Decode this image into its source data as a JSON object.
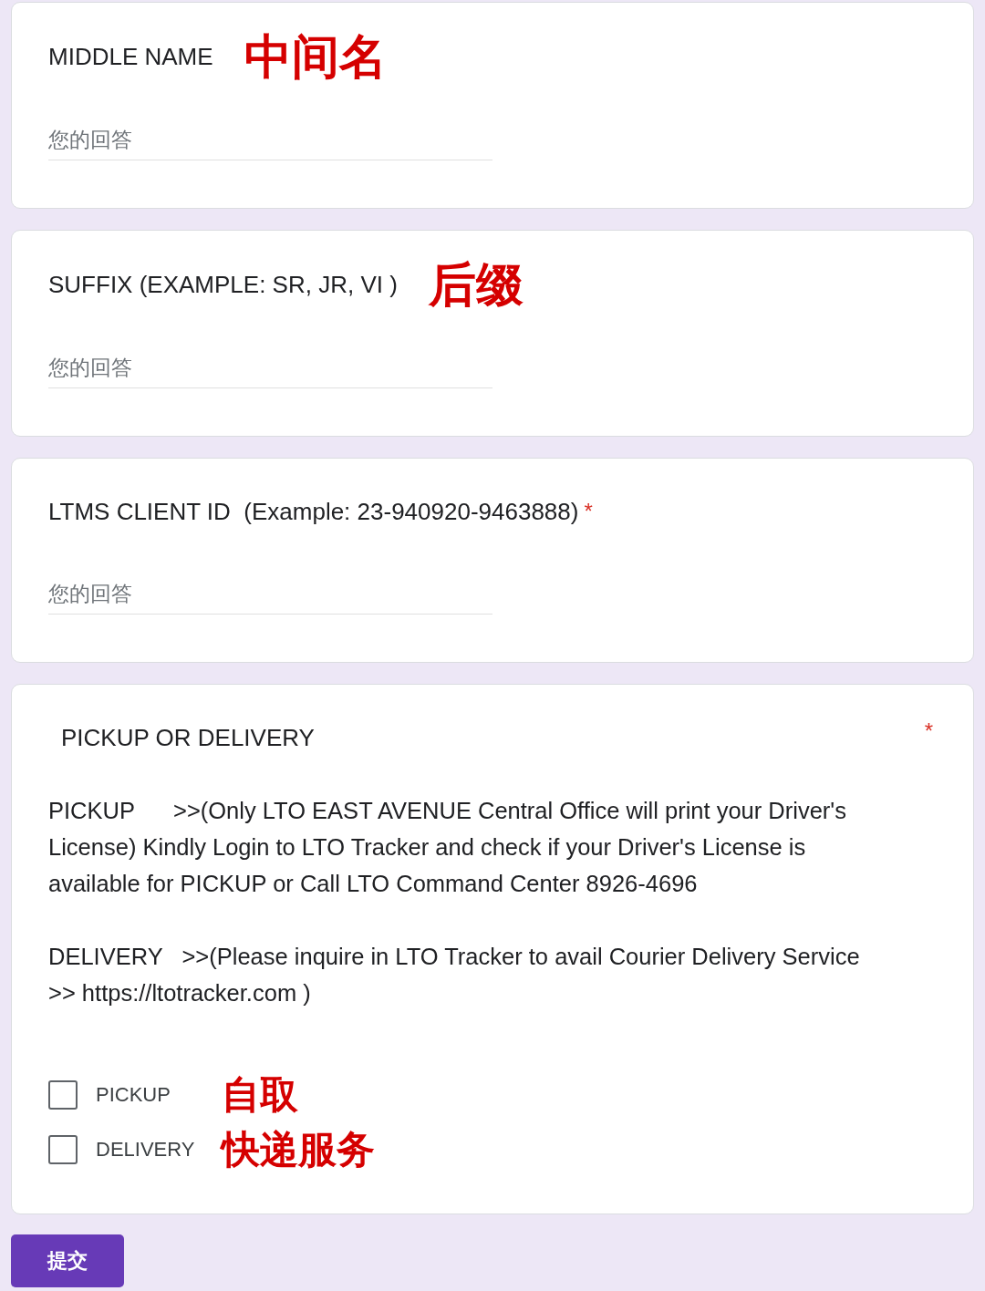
{
  "questions": [
    {
      "kind": "text",
      "title": "MIDDLE NAME",
      "annotation": "中间名",
      "placeholder": "您的回答"
    },
    {
      "kind": "text",
      "title": "SUFFIX (EXAMPLE: SR, JR, VI )",
      "annotation": "后缀",
      "placeholder": "您的回答"
    },
    {
      "kind": "text",
      "title": "LTMS CLIENT ID  (Example: 23-940920-9463888)",
      "required_mark": "*",
      "placeholder": "您的回答"
    },
    {
      "kind": "checkbox",
      "title": "PICKUP OR DELIVERY",
      "required_mark": "*",
      "description": [
        "PICKUP      >>(Only LTO EAST AVENUE Central Office will print your Driver's License) Kindly Login to LTO Tracker and check if your Driver's License is available for PICKUP or Call LTO Command Center 8926-4696",
        "DELIVERY   >>(Please inquire in LTO Tracker to avail Courier Delivery Service >> https://ltotracker.com )"
      ],
      "options": [
        {
          "label": "PICKUP",
          "checked": false,
          "annotation": "自取"
        },
        {
          "label": "DELIVERY",
          "checked": false,
          "annotation": "快递服务"
        }
      ]
    }
  ],
  "submit": {
    "label": "提交"
  }
}
